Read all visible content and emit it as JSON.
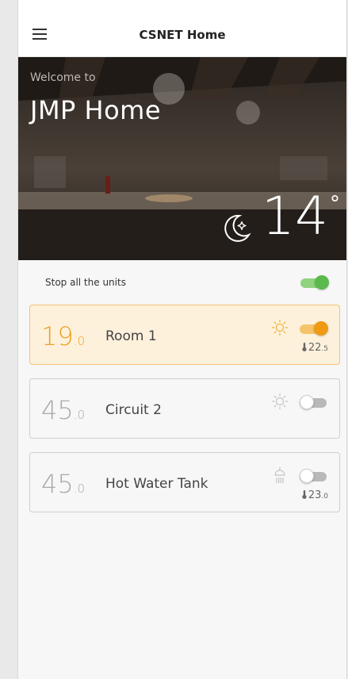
{
  "app": {
    "title": "CSNET Home"
  },
  "header": {
    "welcome": "Welcome to",
    "home_name": "JMP Home",
    "outdoor_temp": "14",
    "degree_symbol": "°",
    "weather_icon": "moon-stars-icon"
  },
  "stop_all": {
    "label": "Stop all the units",
    "on": true
  },
  "units": [
    {
      "setpoint_int": "19",
      "setpoint_dec": ".0",
      "name": "Room 1",
      "mode_icon": "sun-icon",
      "toggle_on": true,
      "room_temp_int": "22",
      "room_temp_dec": ".5",
      "active": true
    },
    {
      "setpoint_int": "45",
      "setpoint_dec": ".0",
      "name": "Circuit 2",
      "mode_icon": "sun-icon",
      "toggle_on": false,
      "active": false
    },
    {
      "setpoint_int": "45",
      "setpoint_dec": ".0",
      "name": "Hot Water Tank",
      "mode_icon": "shower-icon",
      "toggle_on": false,
      "room_temp_int": "23",
      "room_temp_dec": ".0",
      "active": false
    }
  ],
  "colors": {
    "accent_orange": "#f09a13",
    "toggle_green": "#5cb94d",
    "inactive_grey": "#aaaaaa"
  }
}
